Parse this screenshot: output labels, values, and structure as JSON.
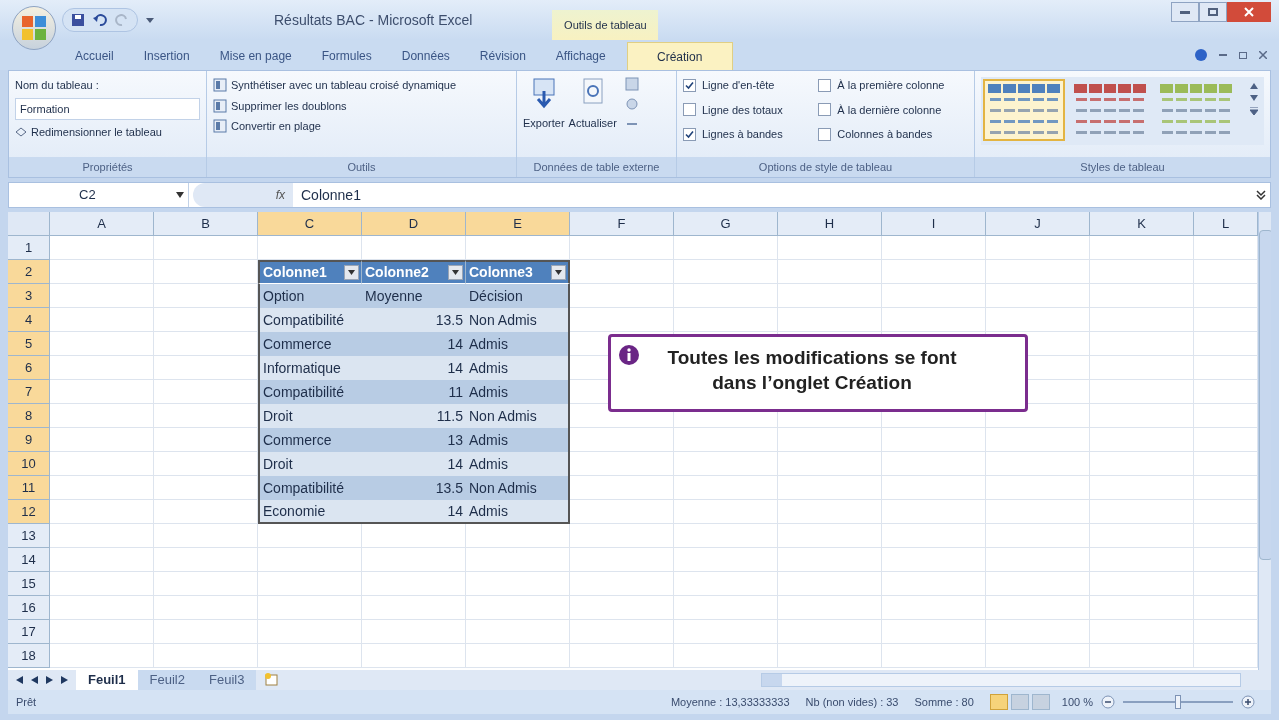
{
  "window": {
    "title": "Résultats BAC - Microsoft Excel",
    "context_tab_group": "Outils de tableau"
  },
  "ribbon_tabs": [
    {
      "label": "Accueil",
      "selected": false
    },
    {
      "label": "Insertion",
      "selected": false
    },
    {
      "label": "Mise en page",
      "selected": false
    },
    {
      "label": "Formules",
      "selected": false
    },
    {
      "label": "Données",
      "selected": false
    },
    {
      "label": "Révision",
      "selected": false
    },
    {
      "label": "Affichage",
      "selected": false
    },
    {
      "label": "Création",
      "selected": true
    }
  ],
  "properties_group": {
    "label": "Propriétés",
    "name_label": "Nom du tableau :",
    "name_value": "Formation",
    "resize_button": "Redimensionner le tableau"
  },
  "tools_group": {
    "label": "Outils",
    "buttons": [
      "Synthétiser avec un tableau croisé dynamique",
      "Supprimer les doublons",
      "Convertir en plage"
    ]
  },
  "external_group": {
    "label": "Données de table externe",
    "buttons": [
      "Exporter",
      "Actualiser"
    ]
  },
  "style_options_group": {
    "label": "Options de style de tableau",
    "options": [
      {
        "label": "Ligne d'en-tête",
        "checked": true
      },
      {
        "label": "Ligne des totaux",
        "checked": false
      },
      {
        "label": "Lignes à bandes",
        "checked": true
      },
      {
        "label": "À la première colonne",
        "checked": false
      },
      {
        "label": "À la dernière colonne",
        "checked": false
      },
      {
        "label": "Colonnes à bandes",
        "checked": false
      }
    ]
  },
  "styles_group": {
    "label": "Styles de tableau",
    "styles": [
      {
        "color": "#4f81bd",
        "selected": true
      },
      {
        "color": "#c0504d",
        "selected": false
      },
      {
        "color": "#9bbb59",
        "selected": false
      }
    ]
  },
  "formula_bar": {
    "cell": "C2",
    "fx": "fx",
    "value": "Colonne1"
  },
  "columns": [
    {
      "label": "A",
      "selected": false
    },
    {
      "label": "B",
      "selected": false
    },
    {
      "label": "C",
      "selected": true
    },
    {
      "label": "D",
      "selected": true
    },
    {
      "label": "E",
      "selected": true
    },
    {
      "label": "F",
      "selected": false
    },
    {
      "label": "G",
      "selected": false
    },
    {
      "label": "H",
      "selected": false
    },
    {
      "label": "I",
      "selected": false
    },
    {
      "label": "J",
      "selected": false
    },
    {
      "label": "K",
      "selected": false
    },
    {
      "label": "L",
      "selected": false
    }
  ],
  "rows": [
    {
      "label": "1",
      "selected": false
    },
    {
      "label": "2",
      "selected": true
    },
    {
      "label": "3",
      "selected": true
    },
    {
      "label": "4",
      "selected": true
    },
    {
      "label": "5",
      "selected": true
    },
    {
      "label": "6",
      "selected": true
    },
    {
      "label": "7",
      "selected": true
    },
    {
      "label": "8",
      "selected": true
    },
    {
      "label": "9",
      "selected": true
    },
    {
      "label": "10",
      "selected": true
    },
    {
      "label": "11",
      "selected": true
    },
    {
      "label": "12",
      "selected": true
    },
    {
      "label": "13",
      "selected": false
    },
    {
      "label": "14",
      "selected": false
    },
    {
      "label": "15",
      "selected": false
    },
    {
      "label": "16",
      "selected": false
    },
    {
      "label": "17",
      "selected": false
    },
    {
      "label": "18",
      "selected": false
    }
  ],
  "table": {
    "headers": [
      "Colonne1",
      "Colonne2",
      "Colonne3"
    ],
    "rows": [
      [
        "Option",
        "Moyenne",
        "Décision"
      ],
      [
        "Compatibilité",
        "13.5",
        "Non Admis"
      ],
      [
        "Commerce",
        "14",
        "Admis"
      ],
      [
        "Informatique",
        "14",
        "Admis"
      ],
      [
        "Compatibilité",
        "11",
        "Admis"
      ],
      [
        "Droit",
        "11.5",
        "Non Admis"
      ],
      [
        "Commerce",
        "13",
        "Admis"
      ],
      [
        "Droit",
        "14",
        "Admis"
      ],
      [
        "Compatibilité",
        "13.5",
        "Non Admis"
      ],
      [
        "Economie",
        "14",
        "Admis"
      ]
    ]
  },
  "callout": {
    "text": "Toutes les modifications se font dans l’onglet Création"
  },
  "sheet_tabs": [
    {
      "label": "Feuil1",
      "selected": true
    },
    {
      "label": "Feuil2",
      "selected": false
    },
    {
      "label": "Feuil3",
      "selected": false
    }
  ],
  "status_bar": {
    "ready": "Prêt",
    "average": "Moyenne : 13,33333333",
    "count": "Nb (non vides) : 33",
    "sum": "Somme : 80",
    "views": [
      {
        "selected": true
      },
      {
        "selected": false
      },
      {
        "selected": false
      }
    ],
    "zoom": "100 %",
    "zoom_level": {
      "level": 0.5
    }
  }
}
